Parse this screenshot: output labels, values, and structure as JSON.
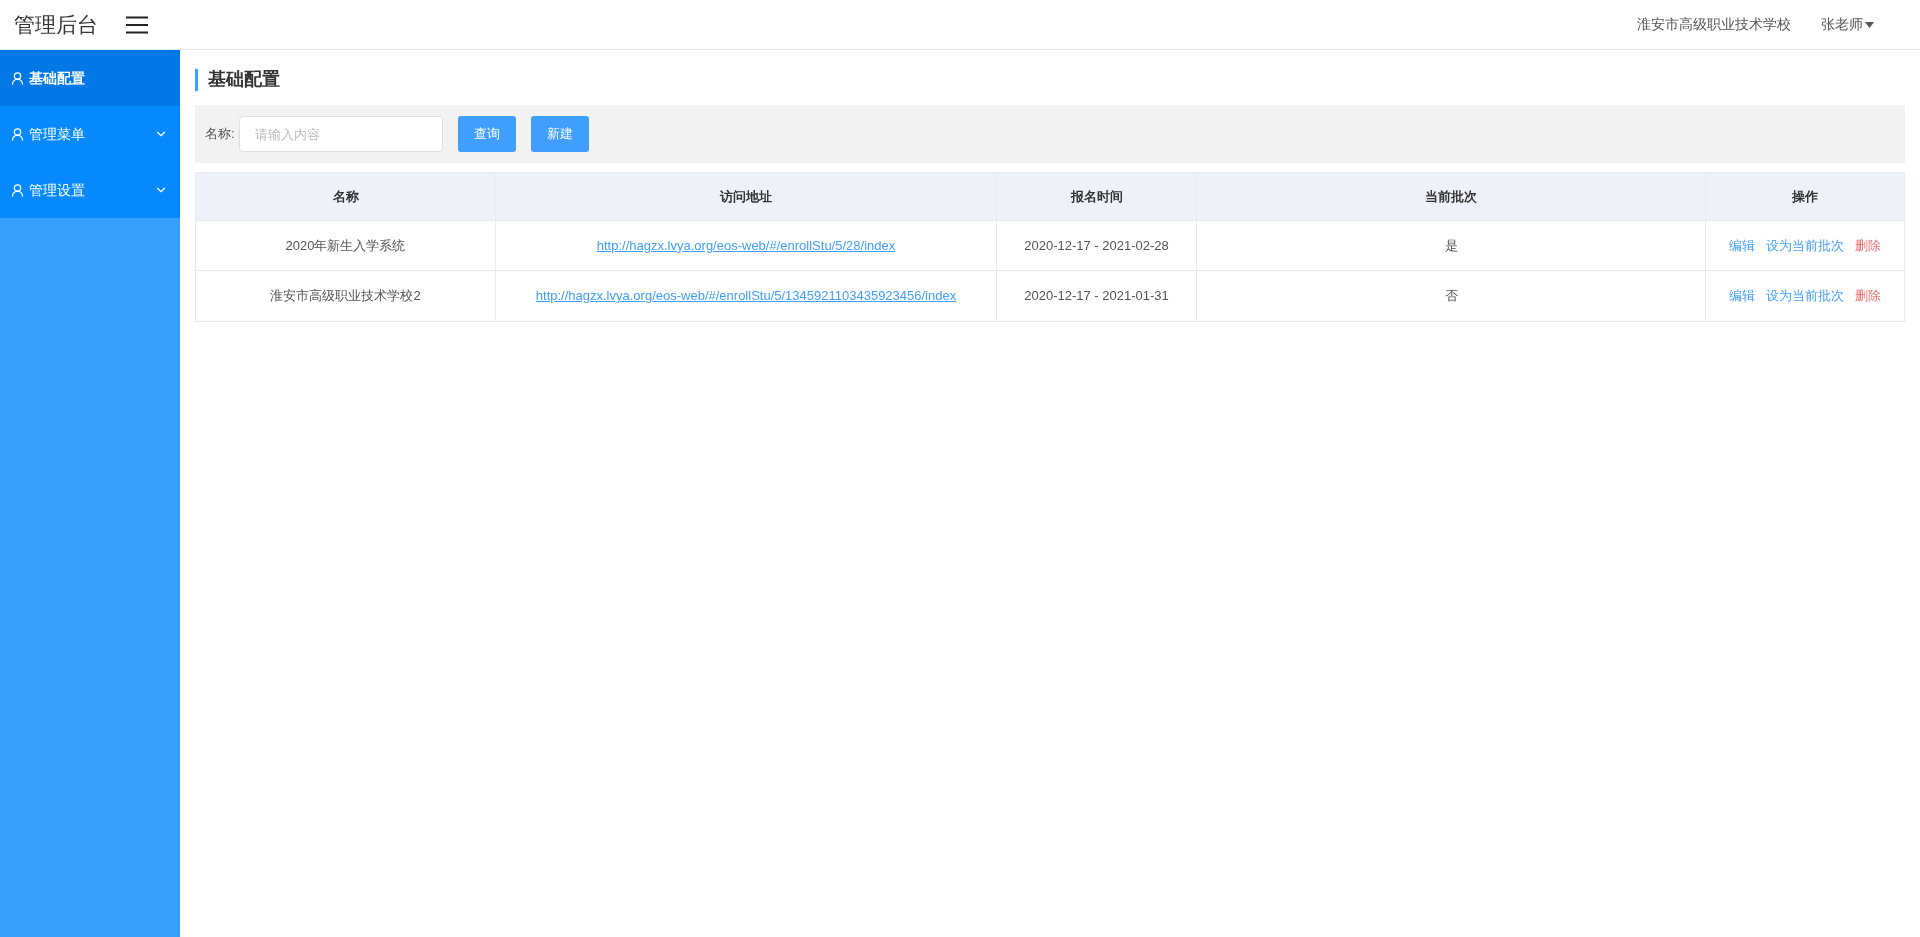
{
  "header": {
    "title": "管理后台",
    "school": "淮安市高级职业技术学校",
    "user": "张老师"
  },
  "sidebar": {
    "items": [
      {
        "label": "基础配置",
        "selected": true,
        "expandable": false
      },
      {
        "label": "管理菜单",
        "selected": false,
        "expandable": true
      },
      {
        "label": "管理设置",
        "selected": false,
        "expandable": true
      }
    ]
  },
  "page_title": "基础配置",
  "search": {
    "label": "名称:",
    "placeholder": "请输入内容",
    "buttons": [
      "查询",
      "新建"
    ]
  },
  "table": {
    "columns": [
      "名称",
      "访问地址",
      "报名时间",
      "当前批次",
      "操作"
    ],
    "rows": [
      {
        "name": "2020年新生入学系统",
        "url": "http://hagzx.lvya.org/eos-web/#/enrollStu/5/28/index",
        "period": "2020-12-17 - 2021-02-28",
        "current": "是",
        "actions": [
          {
            "label": "编辑",
            "kind": "link"
          },
          {
            "label": "设为当前批次",
            "kind": "link"
          },
          {
            "label": "删除",
            "kind": "danger"
          }
        ]
      },
      {
        "name": "淮安市高级职业技术学校2",
        "url": "http://hagzx.lvya.org/eos-web/#/enrollStu/5/1345921103435923456/index",
        "period": "2020-12-17 - 2021-01-31",
        "current": "否",
        "actions": [
          {
            "label": "编辑",
            "kind": "link"
          },
          {
            "label": "设为当前批次",
            "kind": "link"
          },
          {
            "label": "删除",
            "kind": "danger"
          }
        ]
      }
    ]
  }
}
